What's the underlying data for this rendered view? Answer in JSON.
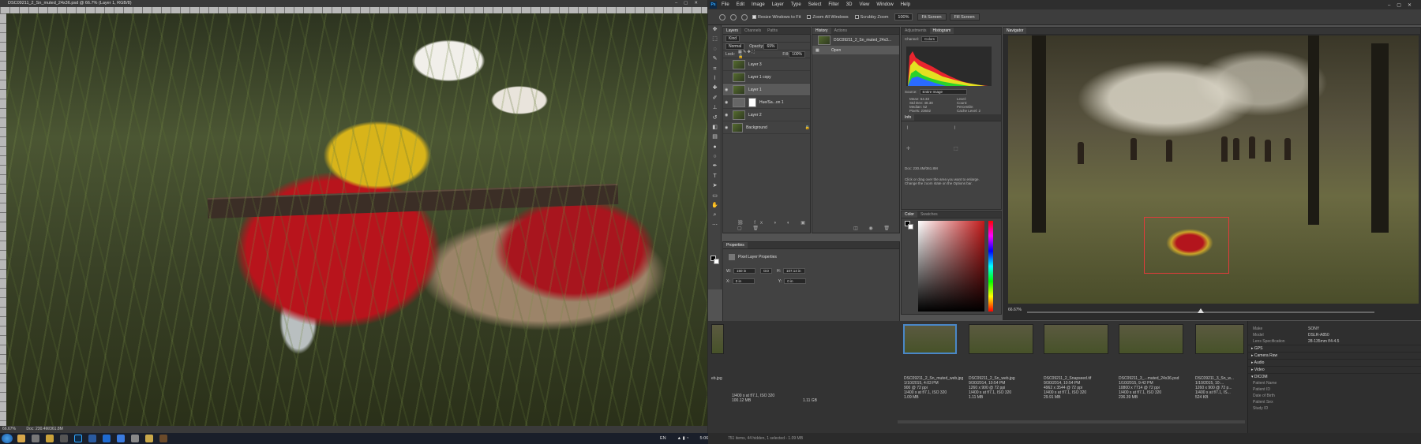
{
  "left_window": {
    "title": "DSC09211_2_Sn_muted_24x36.psd @ 66.7% (Layer 1, RGB/8)",
    "status_zoom": "66.67%",
    "status_doc": "Doc: 230.4M/361.8M"
  },
  "menu": [
    "File",
    "Edit",
    "Image",
    "Layer",
    "Type",
    "Select",
    "Filter",
    "3D",
    "View",
    "Window",
    "Help"
  ],
  "options": {
    "resize_windows": "Resize Windows to Fit",
    "zoom_all": "Zoom All Windows",
    "scrubby": "Scrubby Zoom",
    "zoom_value": "100%",
    "fit_screen": "Fit Screen",
    "fill_screen": "Fill Screen"
  },
  "layers": {
    "tabs": [
      "Layers",
      "Channels",
      "Paths"
    ],
    "kind": "Kind",
    "blend": "Normal",
    "opacity_label": "Opacity:",
    "opacity": "69%",
    "lock_label": "Lock:",
    "fill_label": "Fill:",
    "fill": "100%",
    "items": [
      {
        "name": "Layer 3"
      },
      {
        "name": "Layer 1 copy"
      },
      {
        "name": "Layer 1"
      },
      {
        "name": "Hue/Sa...on 1"
      },
      {
        "name": "Layer 2"
      },
      {
        "name": "Background"
      }
    ]
  },
  "history": {
    "tabs": [
      "History",
      "Actions"
    ],
    "snapshot": "DSC09211_2_Sn_muted_24x3...",
    "items": [
      "Open"
    ]
  },
  "histogram": {
    "tabs": [
      "Adjustments",
      "Histogram"
    ],
    "channel_label": "Channel:",
    "channel": "Colors",
    "source_label": "Source:",
    "source": "Entire Image",
    "stats": [
      "Mean: 64.33",
      "Std Dev: 48.38",
      "Median: 52",
      "Pixels: 23602"
    ],
    "stats2": [
      "Level:",
      "Count:",
      "Percentile:",
      "Cache Level: 2"
    ],
    "info_tab": "Info",
    "doc_info": "Doc: 230.4M/361.8M",
    "hint1": "Click or drag over the area you want to enlarge.",
    "hint2": "Change the zoom state on the Options bar."
  },
  "color": {
    "tabs": [
      "Color",
      "Swatches"
    ]
  },
  "properties": {
    "tab": "Properties",
    "title": "Pixel Layer Properties",
    "w_label": "W:",
    "w": "150 in",
    "go": "GO",
    "h_label": "H:",
    "h": "107.14 in",
    "x_label": "X:",
    "x": "0 in",
    "y_label": "Y:",
    "y": "0 in"
  },
  "navigator": {
    "tab": "Navigator",
    "zoom": "66.67%",
    "view_fraction": 0.5
  },
  "filmstrip": {
    "left_caption": "eb.jpg",
    "left_caption_detail": "1/400 s at f/7.1, ISO 320",
    "left_size": "100.12 MB",
    "left_gb": "1.11 GB",
    "items": [
      {
        "name": "DSC09211_2_Sn_muted_web.jpg",
        "date": "",
        "dims": "1/400 s at f/7.1, ISO 320",
        "size": "1.09 MB"
      },
      {
        "name": "DSC09211_2_Sn_web.jpg",
        "date": "9/30/2014, 10:54 PM",
        "dims": "1260 x 900 @ 72 ppi",
        "detail": "1/400 s at f/7.1, ISO 320",
        "size": "1.11 MB"
      },
      {
        "name": "DSC09211_2_Snapseed.tif",
        "date": "9/30/2014, 10:54 PM",
        "dims": "4962 x 3544 @ 72 ppi",
        "detail": "1/400 s at f/7.1, ISO 320",
        "size": "29.91 MB"
      },
      {
        "name": "DSC09211_3_...muted_24x36.psd",
        "date": "1/10/2015, 9:42 PM",
        "dims": "10800 x 7714 @ 72 ppi",
        "detail": "1/400 s at f/7.1, ISO 320",
        "size": "236.39 MB"
      },
      {
        "name": "DSC09211_3_Sn_w...",
        "date": "1/10/2015, 10:...",
        "dims": "1260 x 900 @ 72 p...",
        "detail": "1/400 s at f/7.1, IS...",
        "size": "524 KB"
      }
    ],
    "first_date": "1/10/2015, 4:03 PM",
    "first_dims": "900 @ 72 ppi",
    "status": "751 items, 44 hidden, 1 selected - 1.09 MB"
  },
  "metadata": {
    "rows": [
      {
        "k": "Make",
        "v": "SONY"
      },
      {
        "k": "Model",
        "v": "DSLR-A850"
      },
      {
        "k": "Lens Specification",
        "v": "28-135mm f/4-4.5"
      }
    ],
    "sections": [
      "GPS",
      "Camera Raw",
      "Audio",
      "Video",
      "DICOM"
    ],
    "dicom_fields": [
      "Patient Name",
      "Patient ID",
      "Date of Birth",
      "Patient Sex",
      "Study ID"
    ]
  },
  "taskbar": {
    "lang": "EN",
    "time": "5:06 PM"
  }
}
